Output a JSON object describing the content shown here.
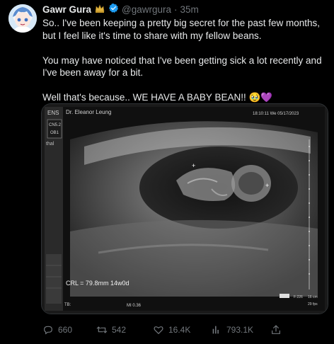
{
  "author": {
    "display_name": "Gawr Gura",
    "handle": "@gawrgura",
    "separator": "·",
    "time": "35m",
    "crown_icon": "crown-icon",
    "verified_icon": "verified-badge-icon",
    "verified_color": "#1d9bf0"
  },
  "tweet": {
    "paragraph1": "So.. I've been keeping a pretty big secret for the past few months, but I feel like it's time to share with my fellow beans.",
    "paragraph2": "You may have noticed that I've been getting sick a lot recently and I've been away for a bit.",
    "paragraph3": "Well that's because.. WE HAVE A BABY BEAN!! 🥹💜"
  },
  "media": {
    "alt": "ultrasound image",
    "top_left": "ENS",
    "doctor": "Dr. Eleanor Leung",
    "datetime": "18:10:11  We  05/17/2023",
    "side_box": [
      "CN5.2",
      "OB1"
    ],
    "side_label": "thal",
    "measurement": "CRL = 79.8mm 14w0d",
    "bottom_left": "TB:",
    "bottom_mid": "MI 0.36",
    "bottom_right_top": "F:226",
    "bottom_right_depth": "16 cm",
    "bottom_right_fps": "29 fps"
  },
  "actions": {
    "replies": "660",
    "retweets": "542",
    "likes": "16.4K",
    "views": "793.1K",
    "icons": [
      "reply-icon",
      "retweet-icon",
      "like-icon",
      "views-icon",
      "share-icon"
    ]
  }
}
